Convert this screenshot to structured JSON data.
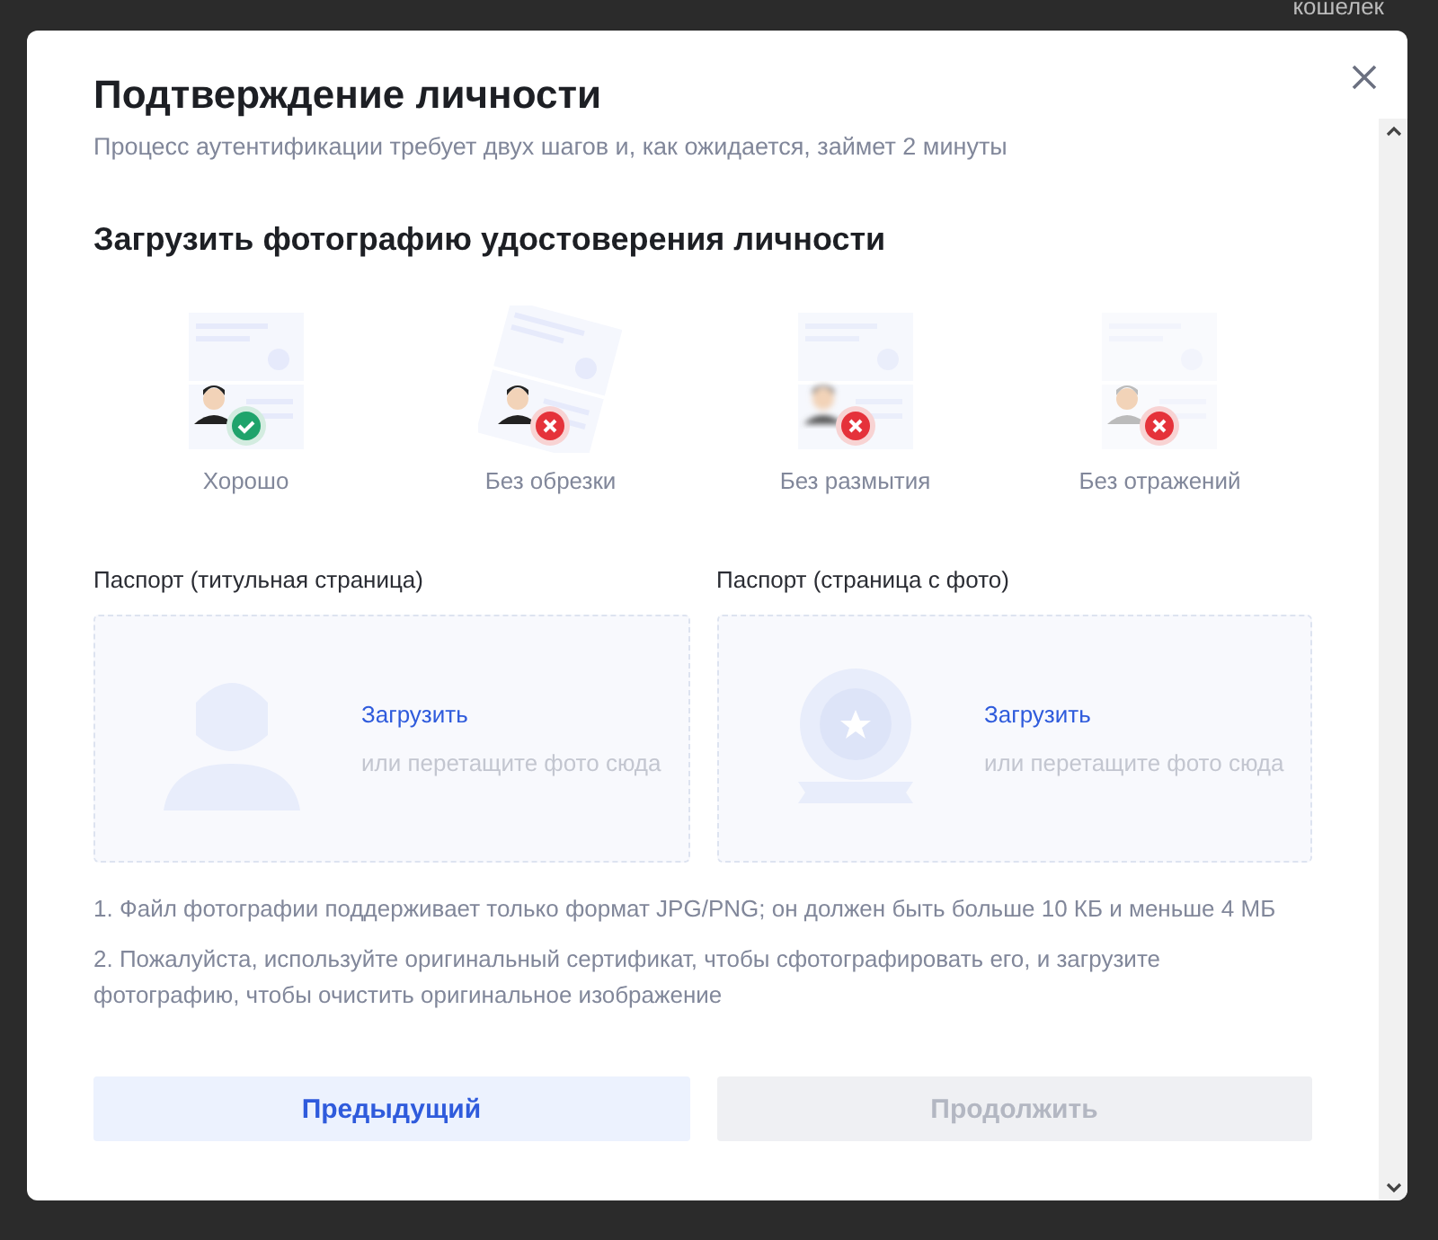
{
  "backdrop": {
    "top_link": "кошелек"
  },
  "dialog": {
    "title": "Подтверждение личности",
    "subtitle": "Процесс аутентификации требует двух шагов и, как ожидается, займет 2 минуты",
    "section_title": "Загрузить фотографию удостоверения личности",
    "examples": [
      {
        "label": "Хорошо",
        "kind": "good"
      },
      {
        "label": "Без обрезки",
        "kind": "cropped"
      },
      {
        "label": "Без размытия",
        "kind": "blurred"
      },
      {
        "label": "Без отражений",
        "kind": "glare"
      }
    ],
    "uploads": [
      {
        "label": "Паспорт (титульная страница)",
        "kind": "person",
        "link": "Загрузить",
        "hint": "или перетащите фото сюда"
      },
      {
        "label": "Паспорт (страница с фото)",
        "kind": "emblem",
        "link": "Загрузить",
        "hint": "или перетащите фото сюда"
      }
    ],
    "notes": [
      "1. Файл фотографии поддерживает только формат JPG/PNG; он должен быть больше 10 КБ и меньше 4 МБ",
      "2. Пожалуйста, используйте оригинальный сертификат, чтобы сфотографировать его, и загрузите фотографию, чтобы очистить оригинальное изображение"
    ],
    "buttons": [
      {
        "label": "Предыдущий",
        "disabled": false
      },
      {
        "label": "Продолжить",
        "disabled": true
      }
    ]
  }
}
